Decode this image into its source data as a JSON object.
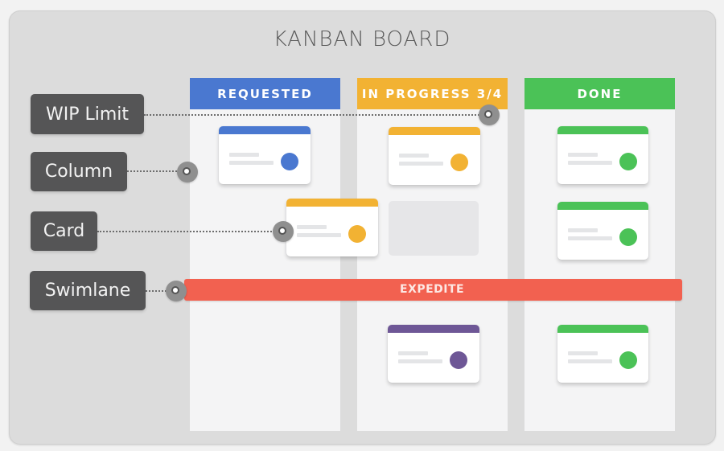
{
  "title": "KANBAN BOARD",
  "colors": {
    "requested": "#4a78d0",
    "in_progress": "#f2b233",
    "done": "#4bc257",
    "expedite": "#f26150",
    "expedite_card": "#6e5796",
    "callout": "#555556"
  },
  "columns": [
    {
      "name": "REQUESTED",
      "color": "#4a78d0"
    },
    {
      "name": "IN PROGRESS 3/4",
      "color": "#f2b233",
      "wip_current": 3,
      "wip_limit": 4
    },
    {
      "name": "DONE",
      "color": "#4bc257"
    }
  ],
  "cards": [
    {
      "column": "REQUESTED",
      "lane": "default",
      "color": "#4a78d0"
    },
    {
      "column": "REQUESTED",
      "lane": "default",
      "color": "#f2b233",
      "state": "moving to IN PROGRESS"
    },
    {
      "column": "IN PROGRESS",
      "lane": "default",
      "color": "#f2b233"
    },
    {
      "column": "IN PROGRESS",
      "lane": "default",
      "color": null,
      "state": "empty slot"
    },
    {
      "column": "DONE",
      "lane": "default",
      "color": "#4bc257"
    },
    {
      "column": "DONE",
      "lane": "default",
      "color": "#4bc257"
    },
    {
      "column": "IN PROGRESS",
      "lane": "EXPEDITE",
      "color": "#6e5796"
    },
    {
      "column": "DONE",
      "lane": "EXPEDITE",
      "color": "#4bc257"
    }
  ],
  "swimlane": {
    "label": "EXPEDITE"
  },
  "callouts": [
    {
      "label": "WIP Limit",
      "target": "IN PROGRESS 3/4 header"
    },
    {
      "label": "Column",
      "target": "REQUESTED column"
    },
    {
      "label": "Card",
      "target": "moving card"
    },
    {
      "label": "Swimlane",
      "target": "EXPEDITE swimlane"
    }
  ]
}
